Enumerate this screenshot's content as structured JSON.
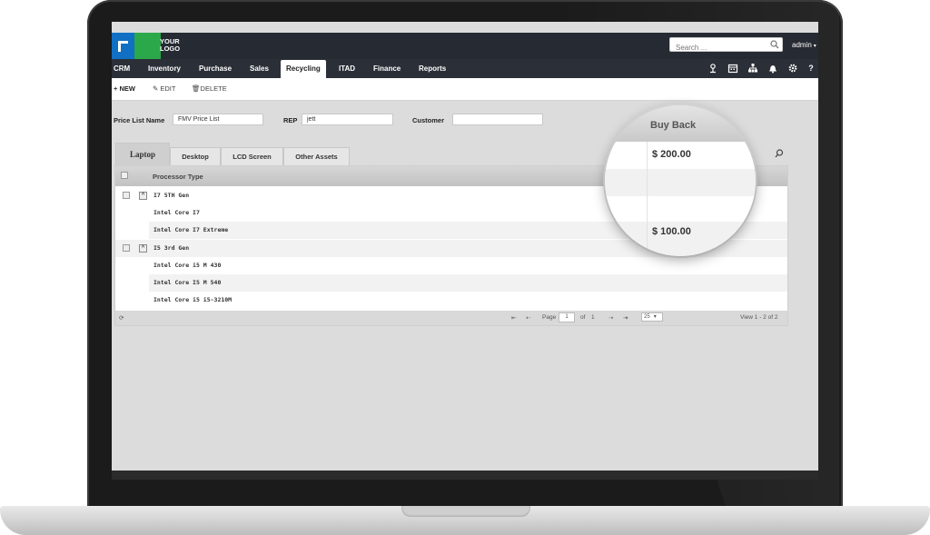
{
  "brand": {
    "logo_text_line1": "YOUR",
    "logo_text_line2": "LOGO",
    "blue": "#1170c4",
    "green": "#2aa84a"
  },
  "topbar": {
    "search_placeholder": "Search ...",
    "user": "admin"
  },
  "nav": {
    "items": [
      "CRM",
      "Inventory",
      "Purchase",
      "Sales",
      "Recycling",
      "ITAD",
      "Finance",
      "Reports"
    ],
    "active": "Recycling",
    "icons": [
      "user-pin-icon",
      "calendar-icon",
      "org-chart-icon",
      "bell-icon",
      "gear-icon",
      "help-icon"
    ],
    "help_label": "?"
  },
  "actions": {
    "new_label": "+ NEW",
    "edit_label": "EDIT",
    "delete_label": "DELETE"
  },
  "form": {
    "price_list_label": "Price List Name",
    "price_list_value": "FMV Price List",
    "rep_label": "REP",
    "rep_value": "jett",
    "customer_label": "Customer",
    "customer_value": ""
  },
  "tabs": [
    "Laptop",
    "Desktop",
    "LCD Screen",
    "Other Assets"
  ],
  "active_tab": "Laptop",
  "grid": {
    "header": "Processor Type",
    "rows": [
      {
        "label": "I7 5TH Gen",
        "type": "group"
      },
      {
        "label": "Intel Core I7",
        "type": "item"
      },
      {
        "label": "Intel Core I7 Extreme",
        "type": "item"
      },
      {
        "label": "I5 3rd Gen",
        "type": "group"
      },
      {
        "label": "Intel Core i5 M 430",
        "type": "item"
      },
      {
        "label": "Intel Core I5 M 540",
        "type": "item"
      },
      {
        "label": "Intel Core i5 i5-3210M",
        "type": "item"
      }
    ]
  },
  "pager": {
    "page_label": "Page",
    "page_value": "1",
    "of_label": "of",
    "total_pages": "1",
    "page_size": "25",
    "view_text": "View 1 - 2 of 2"
  },
  "magnifier": {
    "title": "Buy Back",
    "value_1": "$ 200.00",
    "value_2": "$ 100.00"
  }
}
